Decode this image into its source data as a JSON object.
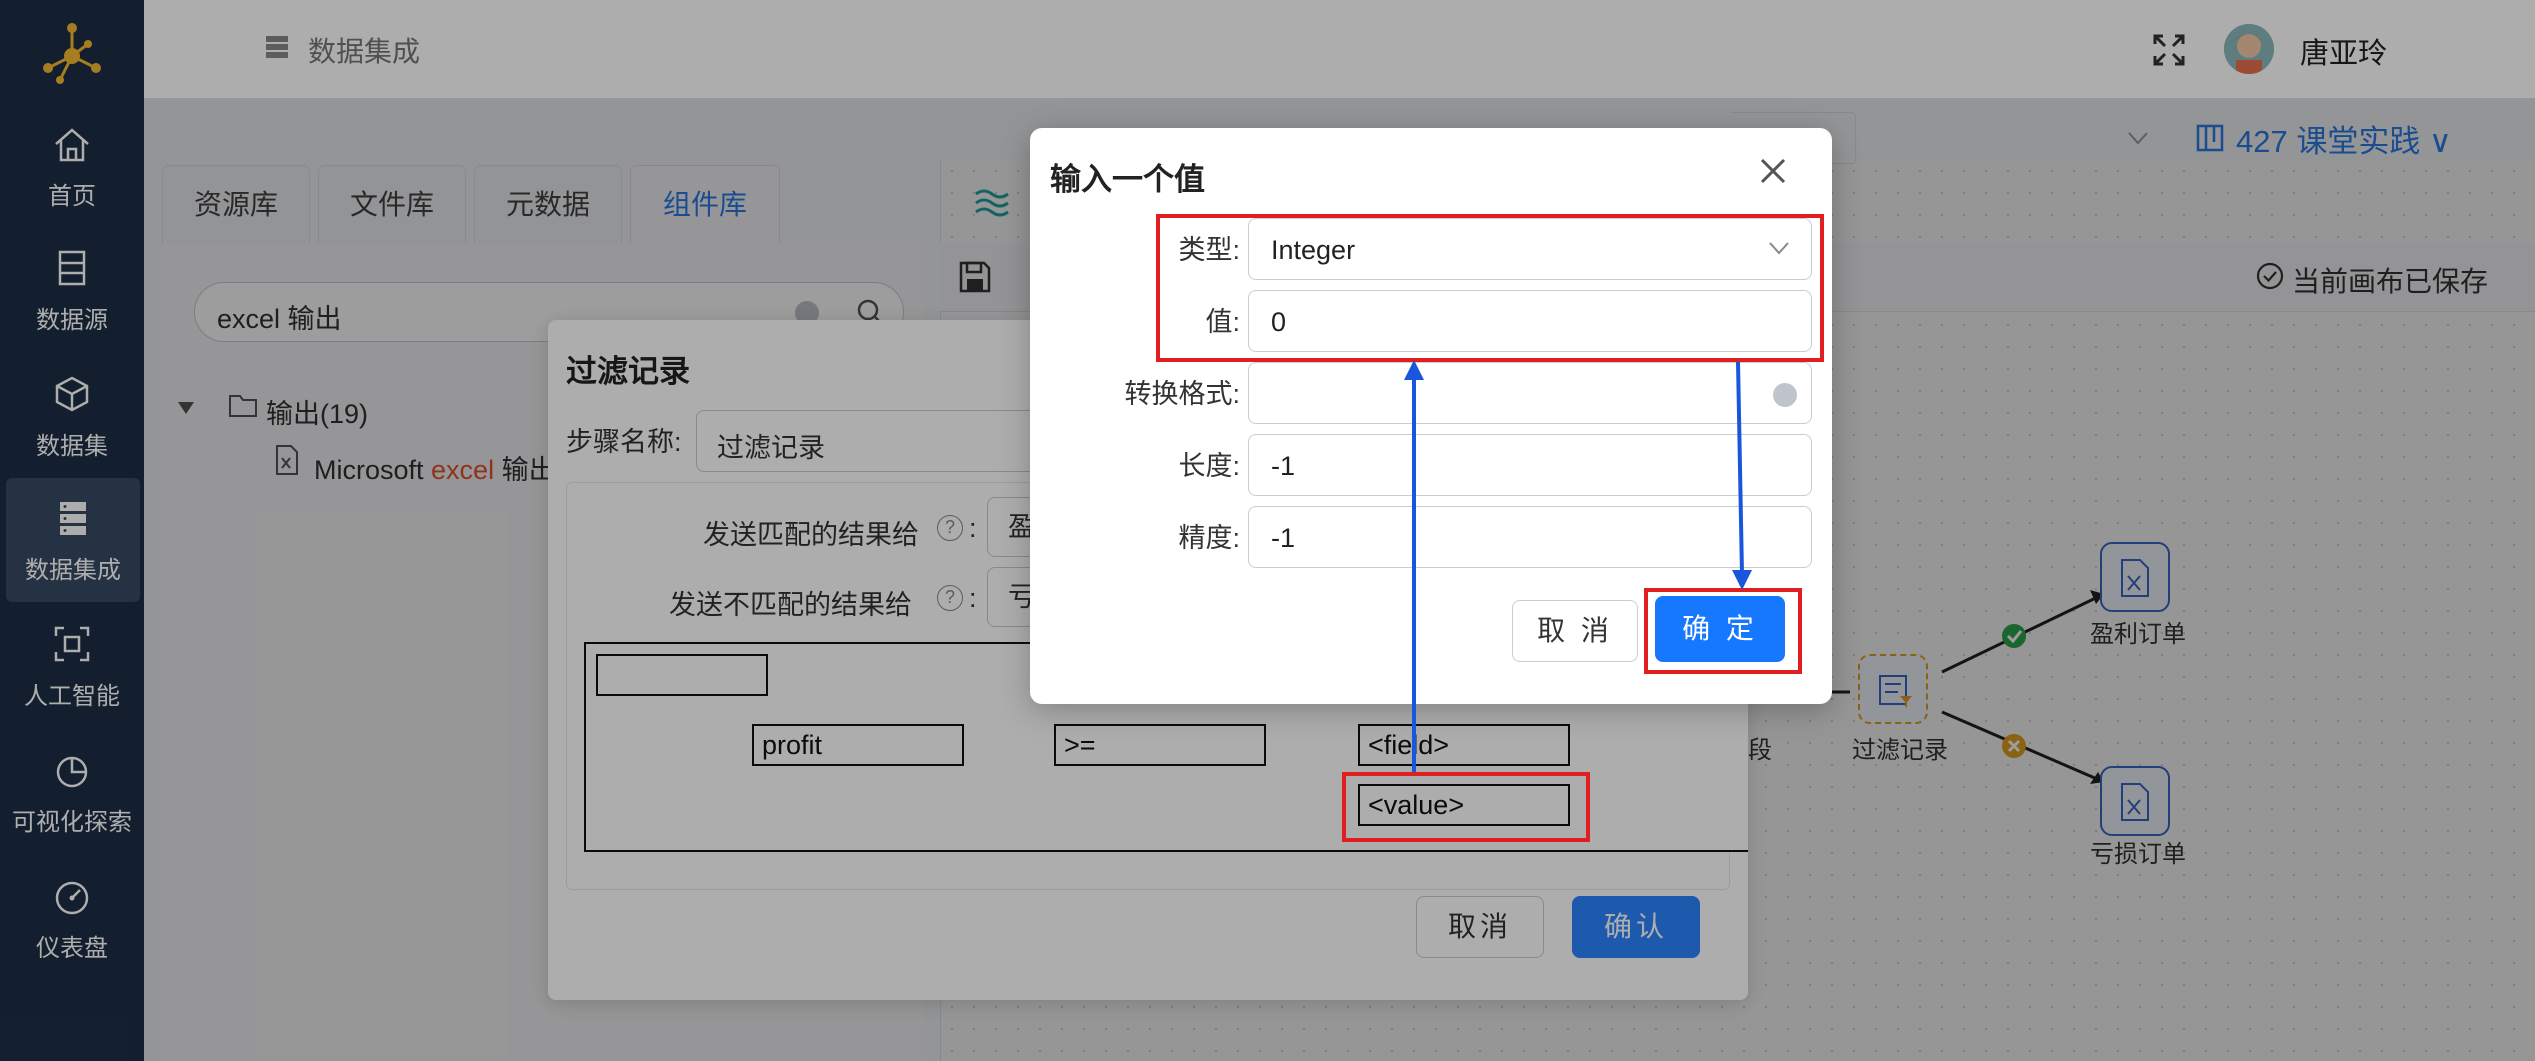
{
  "sidebar": {
    "items": [
      {
        "label": "首页",
        "icon": "home-icon"
      },
      {
        "label": "数据源",
        "icon": "database-icon"
      },
      {
        "label": "数据集",
        "icon": "cube-icon"
      },
      {
        "label": "数据集成",
        "icon": "server-icon",
        "active": true
      },
      {
        "label": "人工智能",
        "icon": "ai-scan-icon"
      },
      {
        "label": "可视化探索",
        "icon": "pie-chart-icon"
      },
      {
        "label": "仪表盘",
        "icon": "gauge-icon"
      }
    ]
  },
  "header": {
    "title": "数据集成",
    "user_name": "唐亚玲"
  },
  "workspace": {
    "tabs": [
      {
        "label": "资源库"
      },
      {
        "label": "文件库"
      },
      {
        "label": "元数据"
      },
      {
        "label": "组件库",
        "active": true
      }
    ],
    "search_value": "excel 输出",
    "tree_root": "输出(19)",
    "tree_child_prefix": "Microsoft ",
    "tree_child_highlight": "excel",
    "tree_child_suffix": " 输出",
    "project_name": "427 课堂实践",
    "saved_status": "当前画布已保存",
    "nodes": {
      "profit_order": "盈利订单",
      "loss_order": "亏损订单",
      "filter_node": "过滤记录",
      "left_partial": "段"
    }
  },
  "filter_dialog": {
    "title": "过滤记录",
    "step_name_label": "步骤名称:",
    "step_name_value": "过滤记录",
    "send_true_label": "发送匹配的结果给",
    "send_true_value": "盈",
    "send_false_label": "发送不匹配的结果给",
    "send_false_value": "亏",
    "condition": {
      "field": "profit",
      "operator": ">=",
      "right_field": "<field>",
      "right_value": "<value>"
    },
    "cancel_label": "取消",
    "ok_label": "确认"
  },
  "value_dialog": {
    "title": "输入一个值",
    "type_label": "类型:",
    "type_value": "Integer",
    "value_label": "值:",
    "value_value": "0",
    "format_label": "转换格式:",
    "format_value": "",
    "length_label": "长度:",
    "length_value": "-1",
    "precision_label": "精度:",
    "precision_value": "-1",
    "cancel_label": "取 消",
    "ok_label": "确 定"
  },
  "colors": {
    "sidebar_bg": "#1d2e45",
    "primary": "#1677ff",
    "highlight_red": "#e02020",
    "arrow_blue": "#1a56db"
  }
}
